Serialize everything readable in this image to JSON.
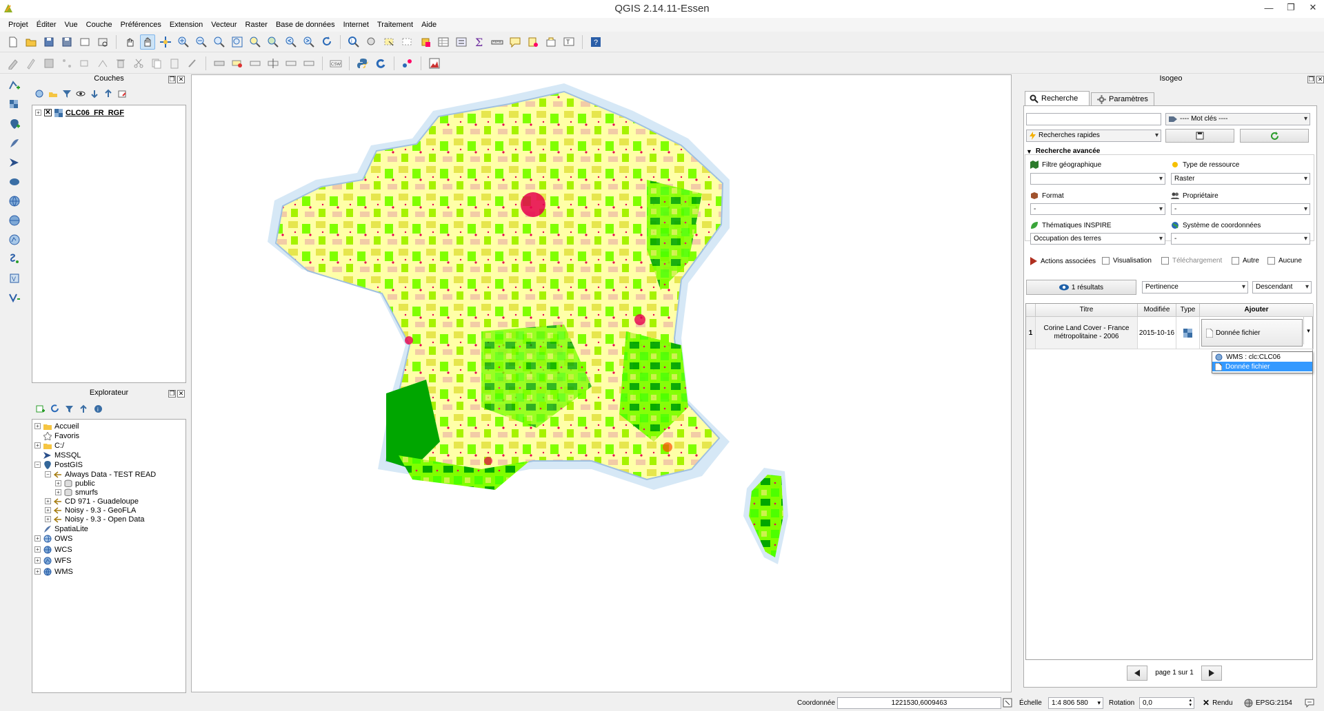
{
  "window": {
    "title": "QGIS 2.14.11-Essen",
    "minimize": "—",
    "restore": "❐",
    "close": "✕"
  },
  "menu": [
    "Projet",
    "Éditer",
    "Vue",
    "Couche",
    "Préférences",
    "Extension",
    "Vecteur",
    "Raster",
    "Base de données",
    "Internet",
    "Traitement",
    "Aide"
  ],
  "layers_panel": {
    "title": "Couches",
    "layer_name": "CLC06_FR_RGF"
  },
  "browser_panel": {
    "title": "Explorateur",
    "items": [
      {
        "label": "Accueil",
        "icon": "folder-icon"
      },
      {
        "label": "Favoris",
        "icon": "star-icon"
      },
      {
        "label": "C:/",
        "icon": "folder-icon"
      },
      {
        "label": "MSSQL",
        "icon": "mssql-icon"
      },
      {
        "label": "PostGIS",
        "icon": "postgis-icon"
      },
      {
        "label": "Always Data - TEST READ",
        "icon": "connection-icon"
      },
      {
        "label": "public",
        "icon": "schema-icon"
      },
      {
        "label": "smurfs",
        "icon": "schema-icon"
      },
      {
        "label": "CD 971 - Guadeloupe",
        "icon": "connection-icon"
      },
      {
        "label": "Noisy - 9.3 - GeoFLA",
        "icon": "connection-icon"
      },
      {
        "label": "Noisy - 9.3 - Open Data",
        "icon": "connection-icon"
      },
      {
        "label": "SpatiaLite",
        "icon": "spatialite-icon"
      },
      {
        "label": "OWS",
        "icon": "globe-icon"
      },
      {
        "label": "WCS",
        "icon": "globe-icon"
      },
      {
        "label": "WFS",
        "icon": "globe-icon"
      },
      {
        "label": "WMS",
        "icon": "globe-icon"
      }
    ]
  },
  "isogeo": {
    "title": "Isogeo",
    "tabs": [
      "Recherche",
      "Paramètres"
    ],
    "search_value": "",
    "keywords": "---- Mot clés ----",
    "quick_search": "Recherches rapides",
    "advanced_title": "Recherche avancée",
    "filters": {
      "geo_label": "Filtre géographique",
      "geo_value": "",
      "type_label": "Type de ressource",
      "type_value": "Raster",
      "format_label": "Format",
      "format_value": "-",
      "owner_label": "Propriétaire",
      "owner_value": "-",
      "inspire_label": "Thématiques INSPIRE",
      "inspire_value": "Occupation des terres",
      "srs_label": "Système de coordonnées",
      "srs_value": "-"
    },
    "actions": {
      "label": "Actions associées",
      "visu": "Visualisation",
      "download": "Téléchargement",
      "other": "Autre",
      "none": "Aucune"
    },
    "results_btn": "1 résultats",
    "sort_by": "Pertinence",
    "sort_order": "Descendant",
    "table": {
      "headers": [
        "Titre",
        "Modifiée",
        "Type",
        "Ajouter"
      ],
      "rows": [
        {
          "num": "1",
          "title": "Corine Land Cover - France métropolitaine - 2006",
          "modified": "2015-10-16",
          "add_selected": "Donnée fichier"
        }
      ],
      "dropdown_options": [
        "WMS : clc:CLC06",
        "Donnée fichier"
      ]
    },
    "pagination": "page 1 sur 1"
  },
  "statusbar": {
    "coord_label": "Coordonnée",
    "coord_value": "1221530,6009463",
    "scale_label": "Échelle",
    "scale_value": "1:4 806 580",
    "rotation_label": "Rotation",
    "rotation_value": "0,0",
    "render_label": "Rendu",
    "crs": "EPSG:2154"
  },
  "colors": {
    "accent": "#3399ff",
    "selection": "#3399ff",
    "urban": "#e6004d",
    "agri": "#ffffa8",
    "forest": "#4dff00"
  }
}
